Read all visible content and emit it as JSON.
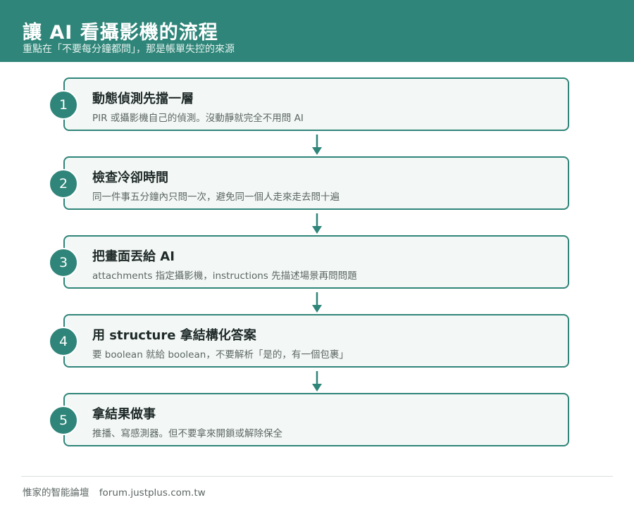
{
  "header": {
    "title": "讓 AI 看攝影機的流程",
    "subtitle": "重點在「不要每分鐘都問」，那是帳單失控的來源"
  },
  "steps": [
    {
      "number": "1",
      "title": "動態偵測先擋一層",
      "desc": "PIR 或攝影機自己的偵測。沒動靜就完全不用問 AI"
    },
    {
      "number": "2",
      "title": "檢查冷卻時間",
      "desc": "同一件事五分鐘內只問一次，避免同一個人走來走去問十遍"
    },
    {
      "number": "3",
      "title": "把畫面丟給 AI",
      "desc": "attachments 指定攝影機，instructions 先描述場景再問問題"
    },
    {
      "number": "4",
      "title": "用 structure 拿結構化答案",
      "desc": "要 boolean 就給 boolean，不要解析「是的，有一個包裹」"
    },
    {
      "number": "5",
      "title": "拿結果做事",
      "desc": "推播、寫感測器。但不要拿來開鎖或解除保全"
    }
  ],
  "footer": {
    "site_name": "惟家的智能論壇",
    "url": "forum.justplus.com.tw"
  },
  "colors": {
    "accent": "#2f8579",
    "card_bg": "#f3f8f6"
  }
}
